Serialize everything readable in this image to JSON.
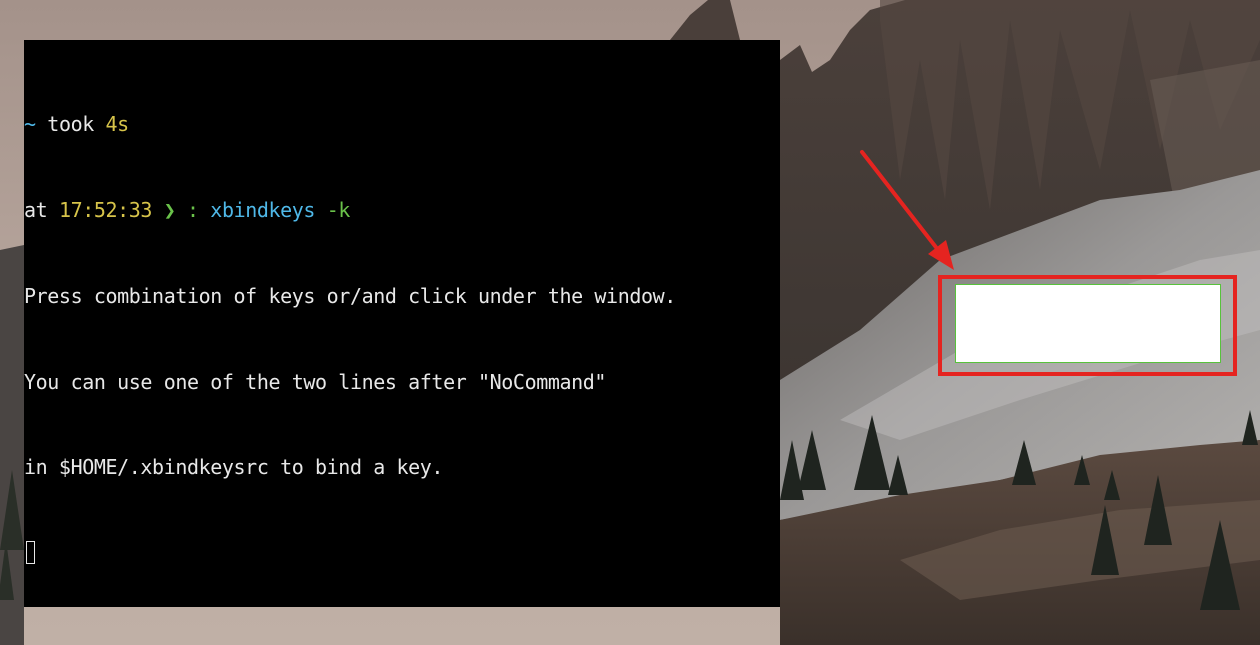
{
  "terminal": {
    "prompt1": {
      "tilde": "~",
      "took_label": " took ",
      "duration": "4s"
    },
    "prompt2": {
      "at_label": "at ",
      "time": "17:52:33",
      "arrow": " ❯ : ",
      "command": "xbindkeys",
      "flag": " -k"
    },
    "output": [
      "Press combination of keys or/and click under the window.",
      "You can use one of the two lines after \"NoCommand\"",
      "in $HOME/.xbindkeysrc to bind a key."
    ]
  },
  "colors": {
    "terminal_bg": "#000000",
    "terminal_fg": "#e8e8e8",
    "accent_cyan": "#4fb8e8",
    "accent_yellow": "#d7c44a",
    "accent_green": "#6ac24a",
    "annotation_red": "#e52420",
    "xbind_window_border": "#58c23c"
  }
}
